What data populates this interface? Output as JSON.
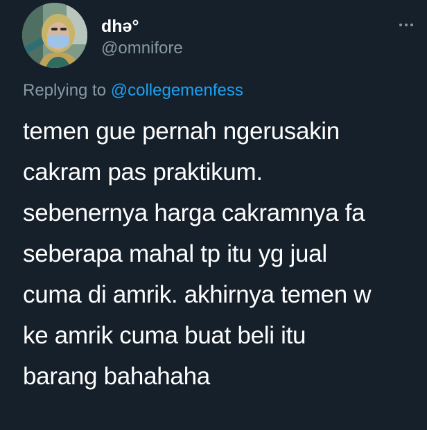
{
  "tweet": {
    "author": {
      "display_name": "dhə°",
      "handle": "@omnifore",
      "avatar_icon": "profile-photo-masked-person"
    },
    "more_icon": "more-options-icon",
    "reply": {
      "prefix": "Replying to ",
      "mention": "@collegemenfess"
    },
    "text_lines": [
      "temen gue pernah ngerusakin",
      "cakram pas praktikum.",
      "sebenernya harga cakramnya fa",
      "seberapa mahal tp itu yg jual",
      "cuma di amrik. akhirnya temen w",
      "ke amrik cuma buat beli itu",
      "barang bahahaha"
    ]
  },
  "colors": {
    "background": "#15202b",
    "text_primary": "#ffffff",
    "text_secondary": "#8899a6",
    "accent": "#1da1f2"
  }
}
